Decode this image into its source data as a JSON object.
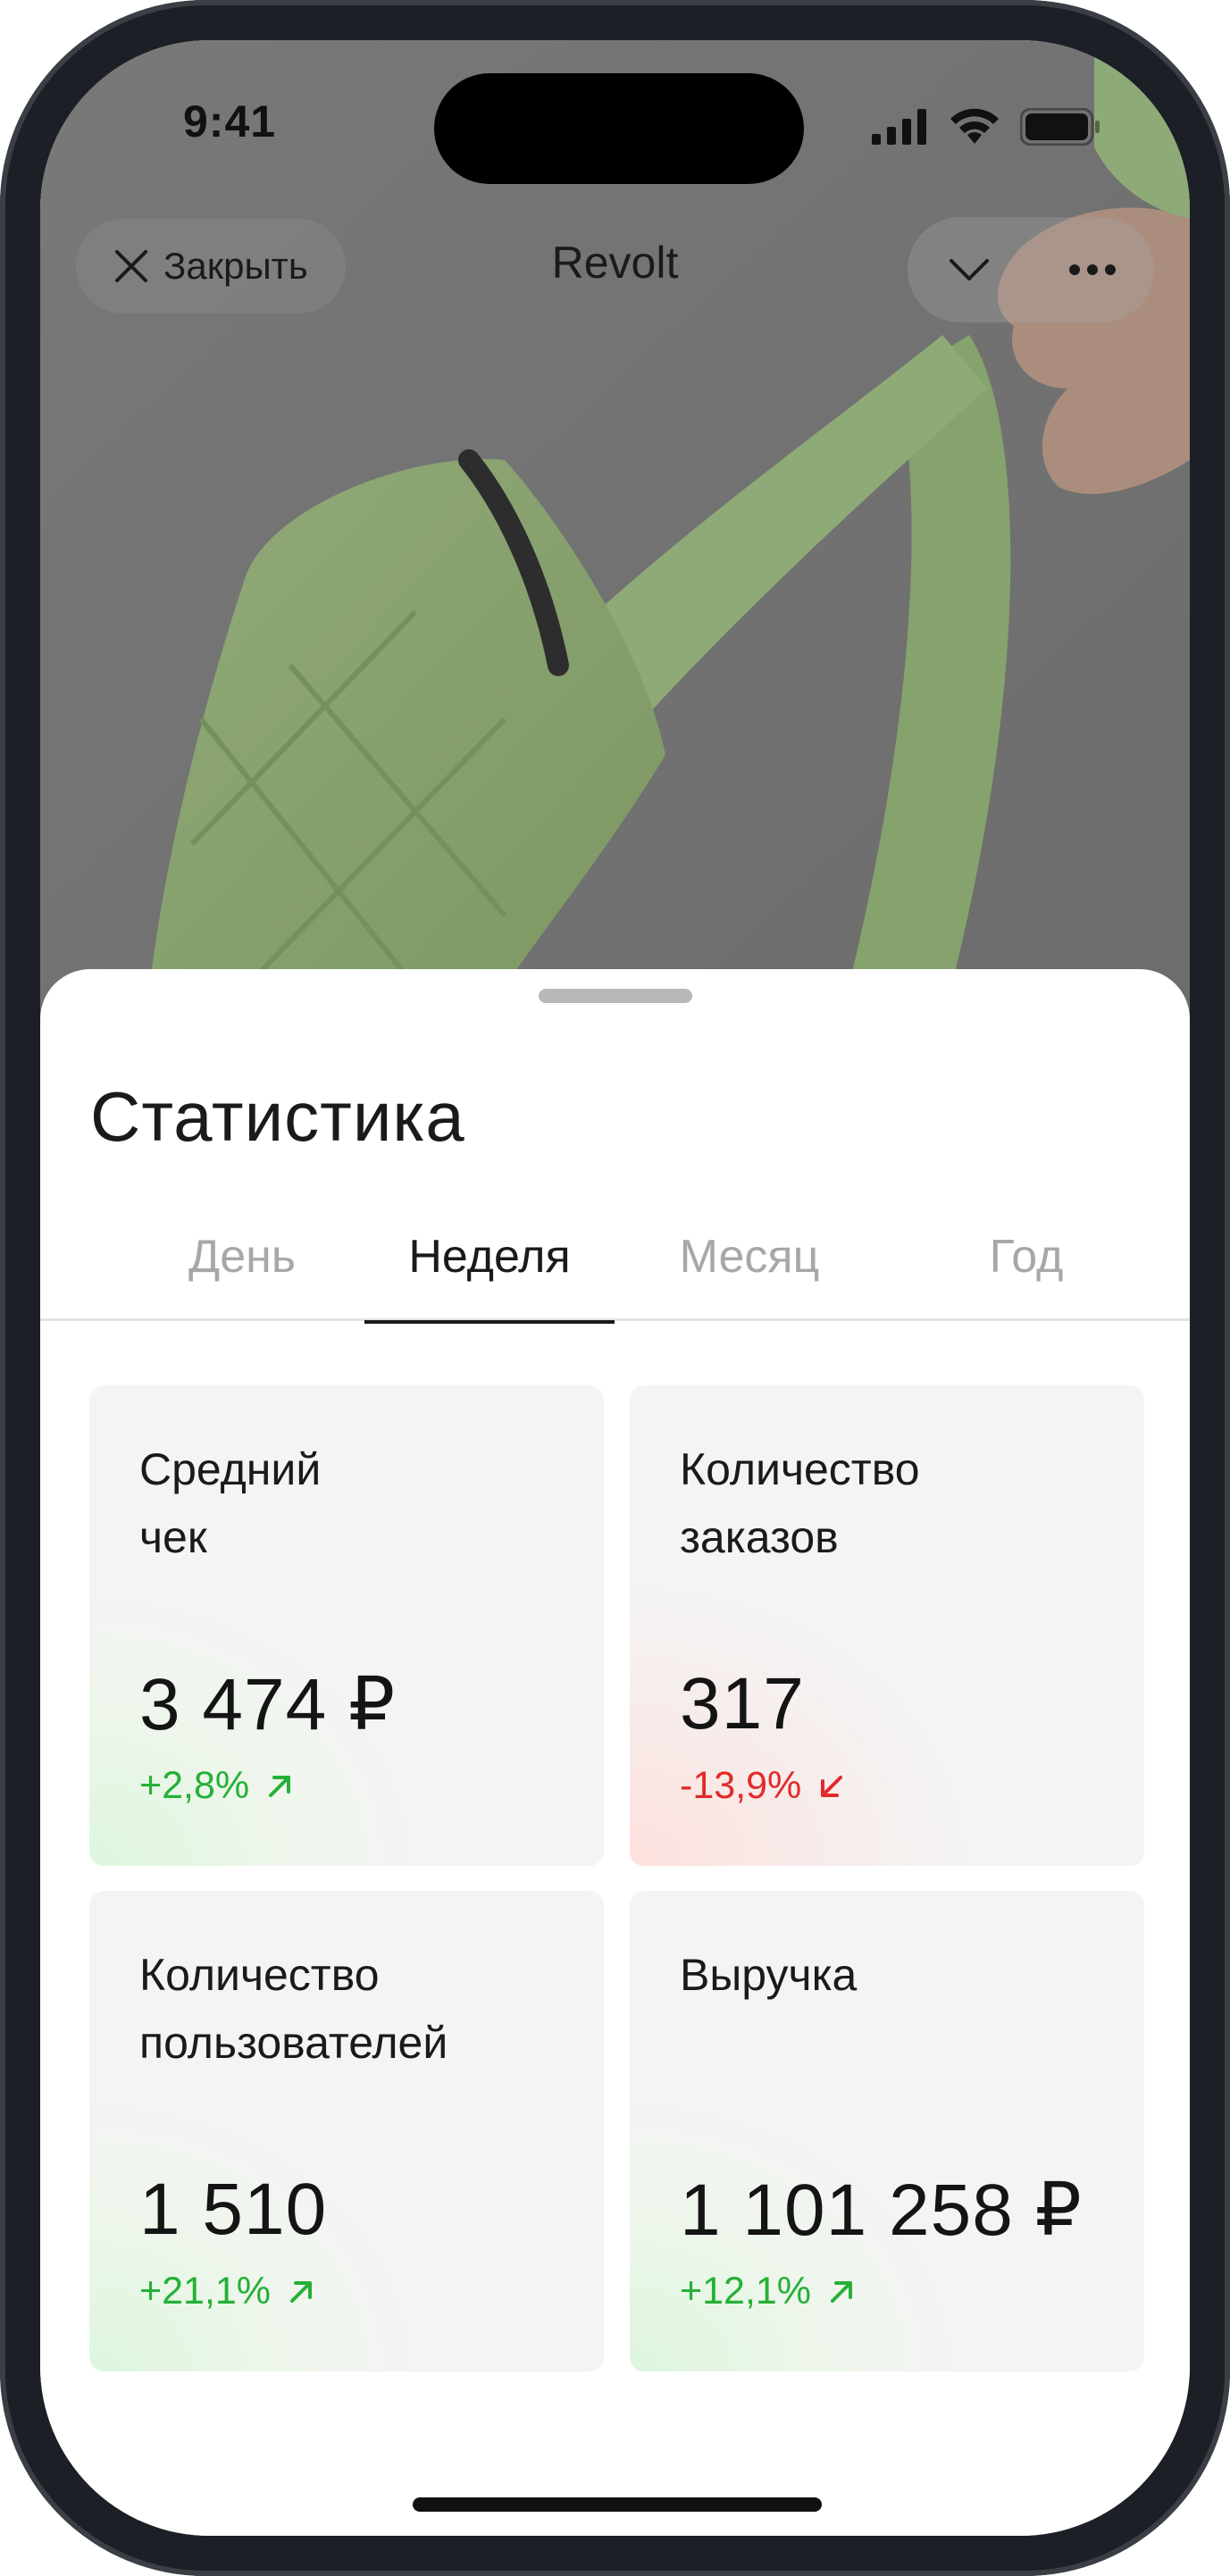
{
  "status_bar": {
    "time": "9:41"
  },
  "nav": {
    "close_label": "Закрыть",
    "title": "Revolt",
    "icons": [
      "close-icon",
      "chevron-down-icon",
      "more-icon"
    ]
  },
  "sheet": {
    "title": "Статистика",
    "tabs": [
      {
        "label": "День",
        "active": false
      },
      {
        "label": "Неделя",
        "active": true
      },
      {
        "label": "Месяц",
        "active": false
      },
      {
        "label": "Год",
        "active": false
      }
    ]
  },
  "stats": [
    {
      "label": "Средний\nчек",
      "value": "3 474 ₽",
      "delta": "+2,8%",
      "trend": "up"
    },
    {
      "label": "Количество\nзаказов",
      "value": "317",
      "delta": "-13,9%",
      "trend": "down"
    },
    {
      "label": "Количество\nпользователей",
      "value": "1 510",
      "delta": "+21,1%",
      "trend": "up"
    },
    {
      "label": "Выручка",
      "value": "1 101 258 ₽",
      "delta": "+12,1%",
      "trend": "up"
    }
  ],
  "colors": {
    "positive": "#25b036",
    "negative": "#e22a2a",
    "text": "#1a1a1a",
    "inactive_tab": "#a7a7a7"
  }
}
